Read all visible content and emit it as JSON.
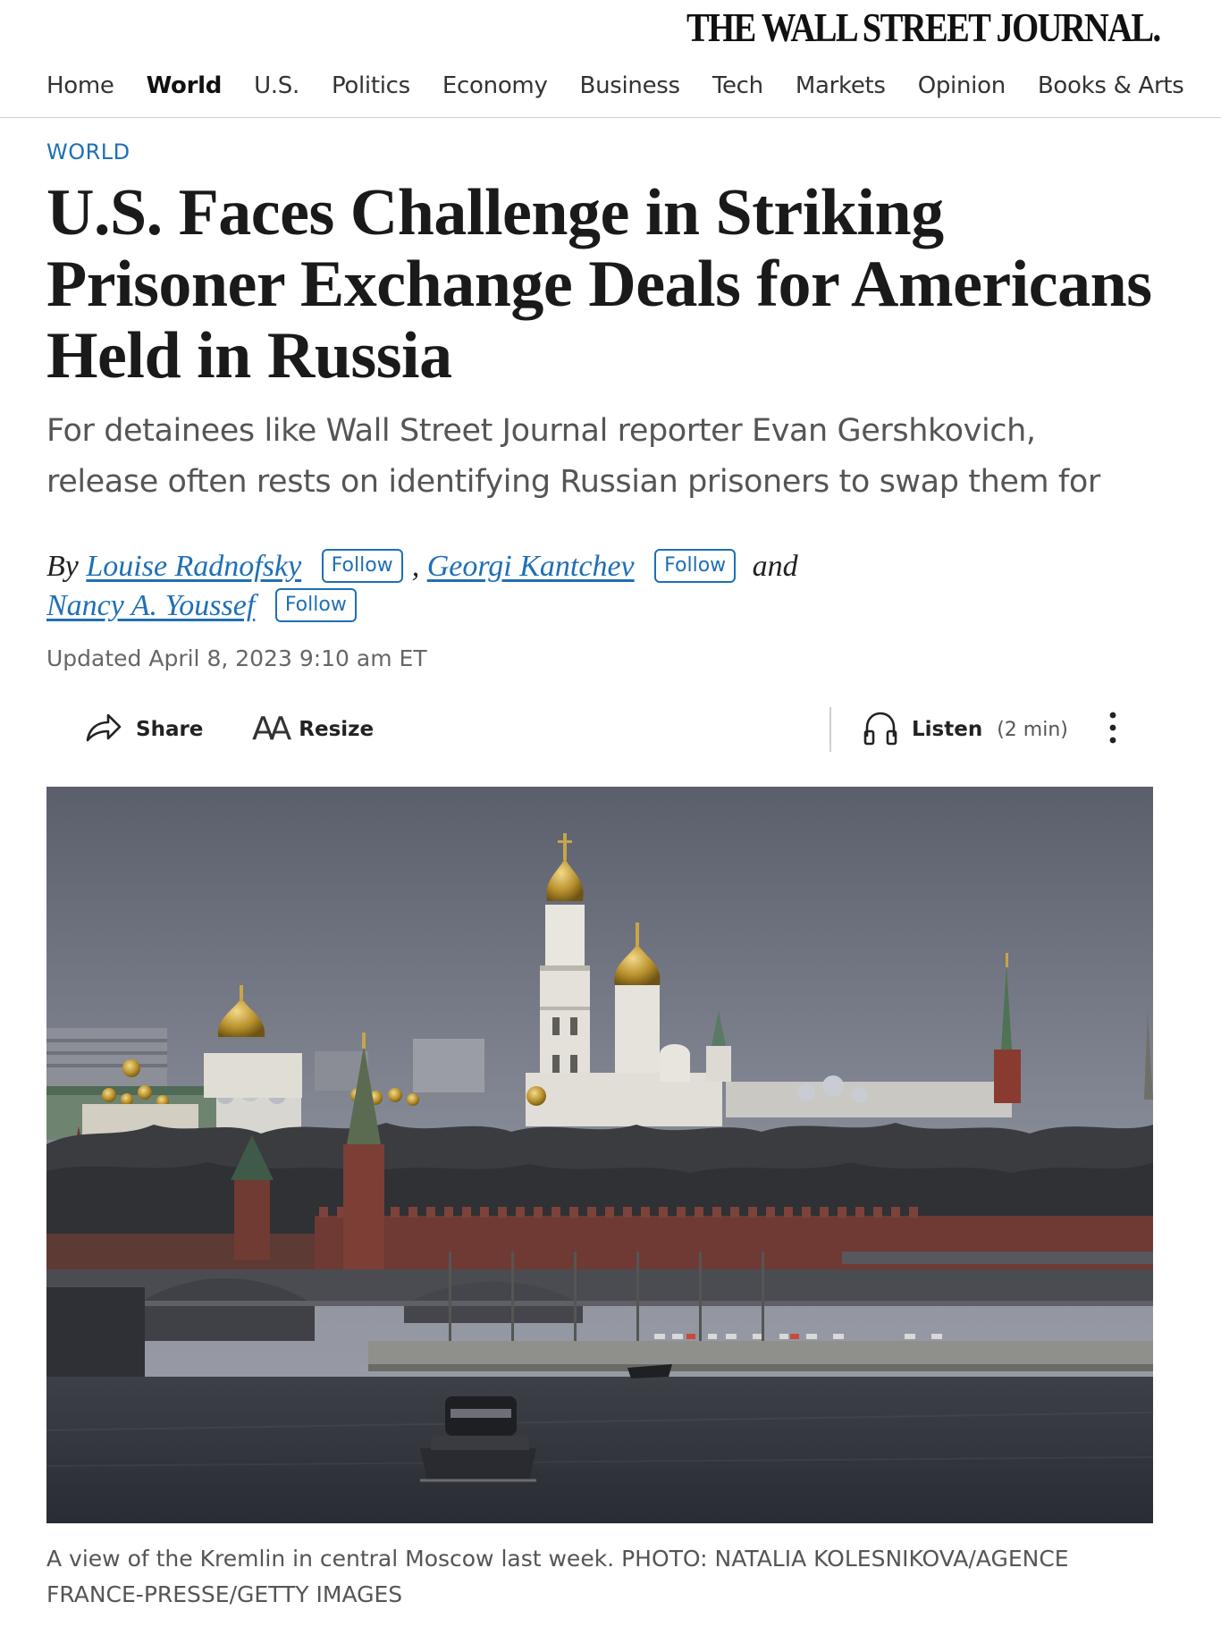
{
  "masthead": {
    "logo": "THE WALL STREET JOURNAL."
  },
  "nav": {
    "items": [
      {
        "label": "Home",
        "active": false
      },
      {
        "label": "World",
        "active": true
      },
      {
        "label": "U.S.",
        "active": false
      },
      {
        "label": "Politics",
        "active": false
      },
      {
        "label": "Economy",
        "active": false
      },
      {
        "label": "Business",
        "active": false
      },
      {
        "label": "Tech",
        "active": false
      },
      {
        "label": "Markets",
        "active": false
      },
      {
        "label": "Opinion",
        "active": false
      },
      {
        "label": "Books & Arts",
        "active": false
      }
    ]
  },
  "article": {
    "section": "WORLD",
    "headline": "U.S. Faces Challenge in Striking Prisoner Exchange Deals for Americans Held in Russia",
    "dek": "For detainees like Wall Street Journal reporter Evan Gershkovich, release often rests on identifying Russian prisoners to swap them for",
    "byline": {
      "by": "By",
      "separator": ",",
      "and": "and",
      "follow_label": "Follow",
      "authors": [
        "Louise Radnofsky",
        "Georgi Kantchev",
        "Nancy A. Youssef"
      ]
    },
    "timestamp": "Updated April 8, 2023 9:10 am ET"
  },
  "toolbar": {
    "share_label": "Share",
    "resize_label": "Resize",
    "resize_glyph": "AA",
    "listen_label": "Listen",
    "listen_duration": "(2 min)"
  },
  "image": {
    "caption": "A view of the Kremlin in central Moscow last week. PHOTO: NATALIA KOLESNIKOVA/AGENCE FRANCE-PRESSE/GETTY IMAGES"
  },
  "colors": {
    "link_blue": "#1f6fb5",
    "text_dark": "#111111",
    "text_muted": "#555555",
    "rule": "#cfcfcf"
  },
  "icons": [
    "share-icon",
    "resize-icon",
    "headphones-icon",
    "more-vertical-icon"
  ]
}
